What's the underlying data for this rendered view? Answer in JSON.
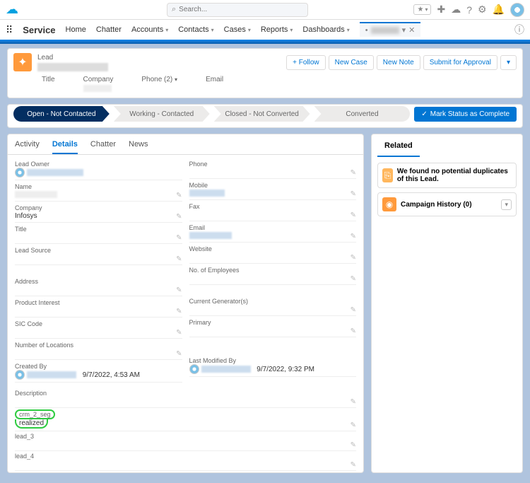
{
  "gh": {
    "search_placeholder": "Search..."
  },
  "nav": {
    "brand": "Service",
    "items": [
      "Home",
      "Chatter",
      "Accounts",
      "Contacts",
      "Cases",
      "Reports",
      "Dashboards"
    ]
  },
  "hl": {
    "type": "Lead",
    "actions": {
      "follow": "+  Follow",
      "new_case": "New Case",
      "new_note": "New Note",
      "submit": "Submit for Approval"
    }
  },
  "compact": {
    "title_lbl": "Title",
    "company_lbl": "Company",
    "phone_lbl": "Phone (2)",
    "email_lbl": "Email"
  },
  "path": {
    "stages": [
      "Open - Not Contacted",
      "Working - Contacted",
      "Closed - Not Converted",
      "Converted"
    ],
    "mark": "Mark Status as Complete"
  },
  "tabs": {
    "activity": "Activity",
    "details": "Details",
    "chatter": "Chatter",
    "news": "News"
  },
  "fields": {
    "left": {
      "lead_owner": "Lead Owner",
      "name": "Name",
      "company": "Company",
      "company_v": "Infosys",
      "title": "Title",
      "lead_source": "Lead Source",
      "address": "Address",
      "product_interest": "Product Interest",
      "sic": "SIC Code",
      "num_loc": "Number of Locations",
      "created_by": "Created By",
      "created_v": "9/7/2022, 4:53 AM"
    },
    "right": {
      "phone": "Phone",
      "mobile": "Mobile",
      "fax": "Fax",
      "email": "Email",
      "website": "Website",
      "no_emp": "No. of Employees",
      "cur_gen": "Current Generator(s)",
      "primary": "Primary",
      "last_mod": "Last Modified By",
      "last_mod_v": "9/7/2022, 9:32 PM"
    },
    "desc": "Description",
    "crm": "crm_2_seg",
    "crm_v": "realized",
    "lead3": "lead_3",
    "lead4": "lead_4"
  },
  "related": {
    "title": "Related",
    "dup": "We found no potential duplicates of this Lead.",
    "camp": "Campaign History (0)"
  }
}
